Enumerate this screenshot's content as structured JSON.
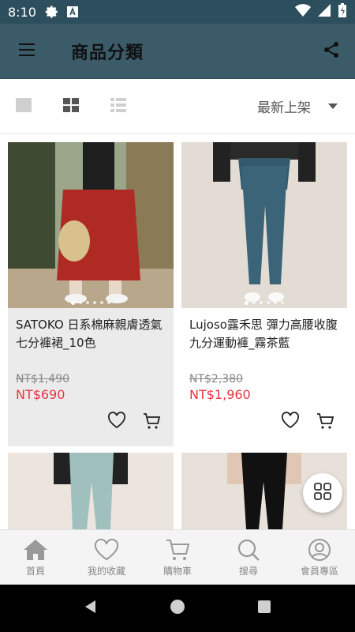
{
  "status_bar": {
    "time": "8:10"
  },
  "app_bar": {
    "title": "商品分類"
  },
  "toolbar": {
    "sort_label": "最新上架"
  },
  "products": [
    {
      "name": "SATOKO 日系棉麻親膚透氣七分褲裙_10色",
      "old_price": "NT$1,490",
      "price": "NT$690"
    },
    {
      "name": "Lujoso露禾思 彈力高腰收腹九分運動褲_霧茶藍",
      "old_price": "NT$2,380",
      "price": "NT$1,960"
    }
  ],
  "bottom_nav": [
    {
      "label": "首頁",
      "icon": "home-icon"
    },
    {
      "label": "我的收藏",
      "icon": "heart-icon"
    },
    {
      "label": "購物車",
      "icon": "cart-icon"
    },
    {
      "label": "搜尋",
      "icon": "search-icon"
    },
    {
      "label": "會員專區",
      "icon": "user-icon"
    }
  ],
  "colors": {
    "app_bar": "#3b5b69",
    "status_bar": "#2d4f5d",
    "sale_price": "#e8343f"
  }
}
